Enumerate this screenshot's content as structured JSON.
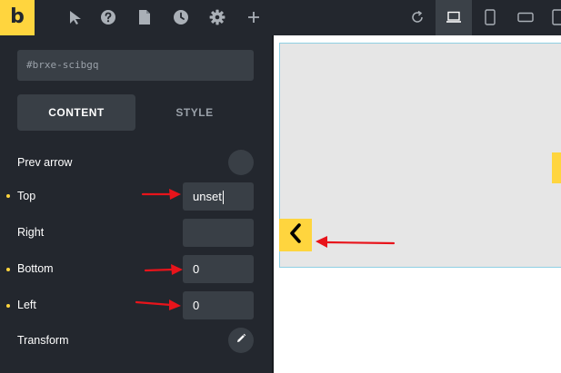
{
  "toolbar": {
    "logo": "b",
    "icons": [
      "pointer-icon",
      "help-icon",
      "page-icon",
      "history-icon",
      "gear-icon",
      "plus-icon"
    ],
    "right_icons": [
      "reload-icon",
      "laptop-icon",
      "phone-portrait-icon",
      "phone-landscape-icon"
    ]
  },
  "panel": {
    "element_id": "#brxe-scibgq",
    "tabs": {
      "content": "CONTENT",
      "style": "STYLE"
    },
    "rows": {
      "prev_arrow": "Prev arrow",
      "top": "Top",
      "right": "Right",
      "bottom": "Bottom",
      "left": "Left",
      "transform": "Transform"
    },
    "values": {
      "top": "unset",
      "right": "",
      "bottom": "0",
      "left": "0"
    }
  },
  "colors": {
    "accent": "#ffd53e",
    "panel_bg": "#23272e",
    "field_bg": "#393f46",
    "annotation_arrow": "#e8141b",
    "canvas_bg": "#e6e6e6",
    "canvas_border": "#8fd0e3"
  }
}
